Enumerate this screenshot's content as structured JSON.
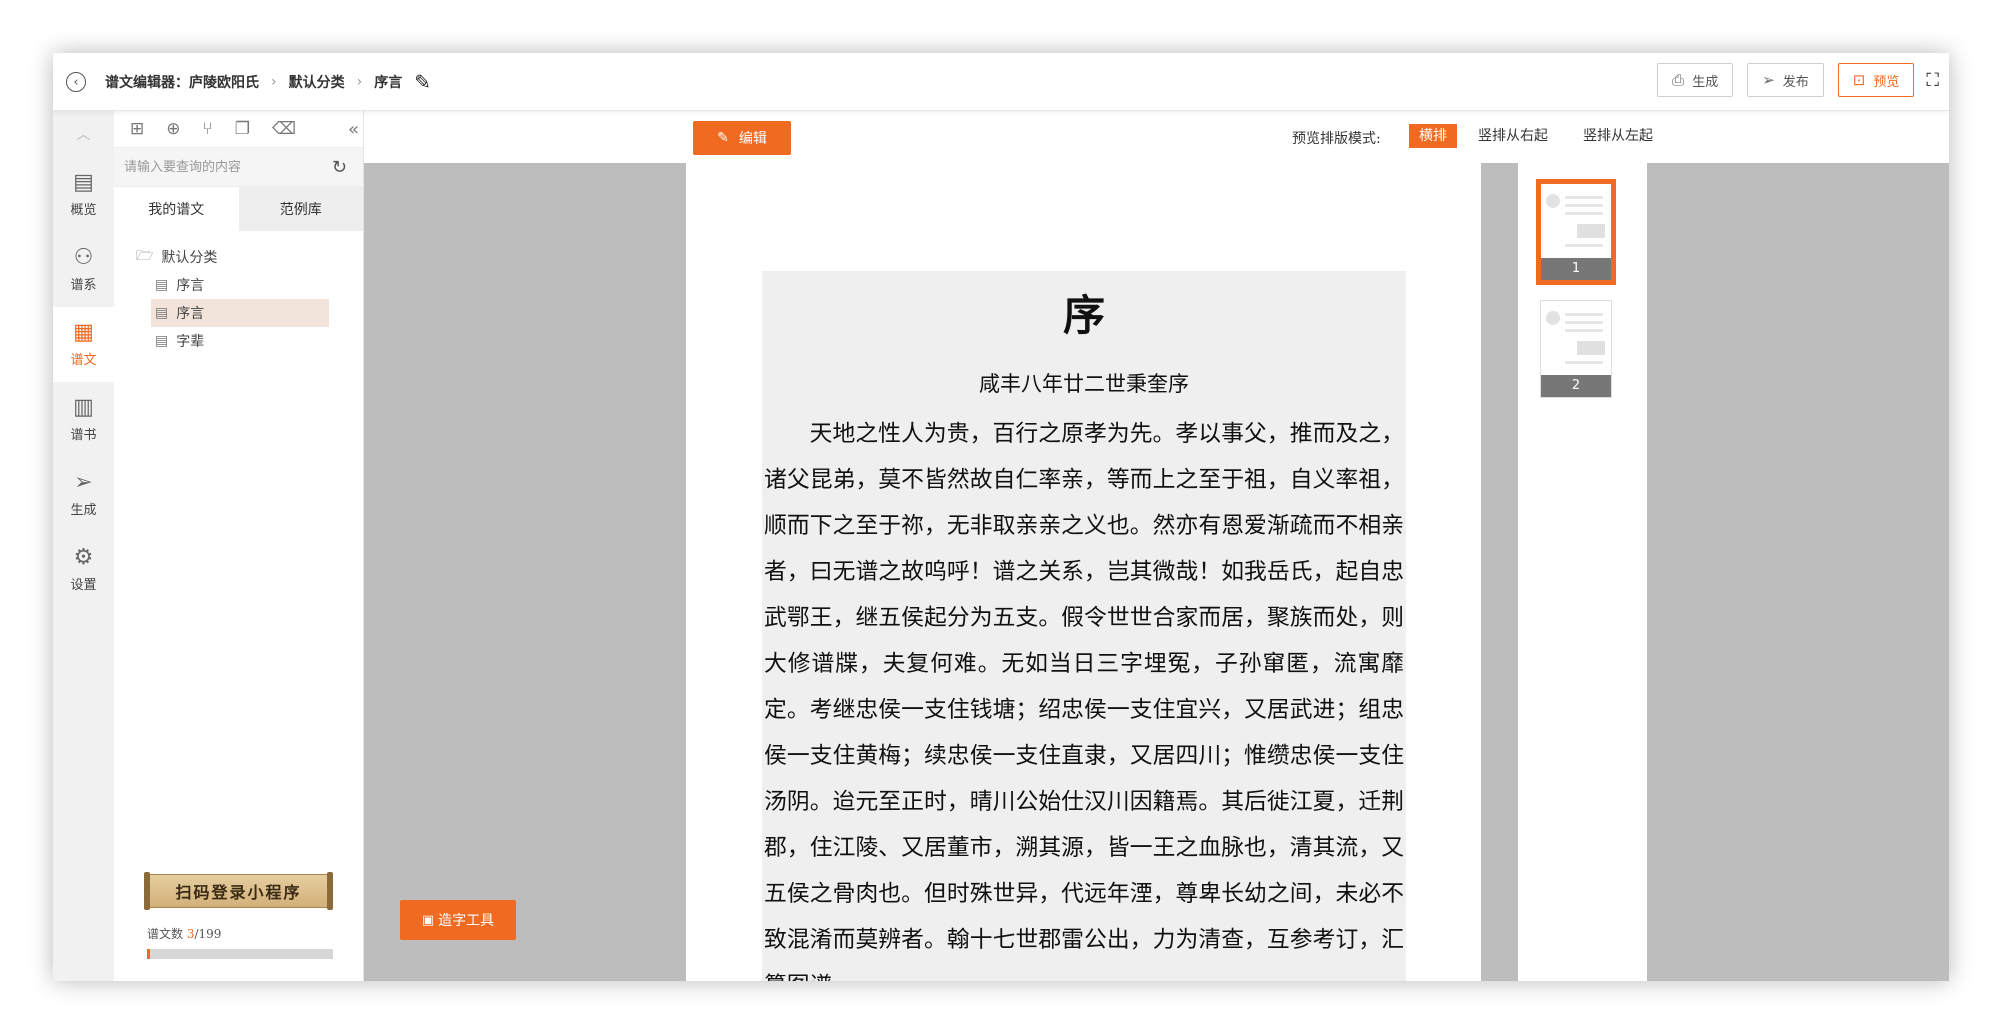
{
  "header": {
    "back_icon": "chevron-left-circle-icon",
    "breadcrumbs": [
      "谱文编辑器：庐陵欧阳氏",
      "默认分类",
      "序言"
    ],
    "actions": {
      "generate": "生成",
      "publish": "发布",
      "preview": "预览"
    }
  },
  "leftnav": {
    "items": [
      {
        "label": "概览",
        "icon": "chart-icon"
      },
      {
        "label": "谱系",
        "icon": "tree-icon"
      },
      {
        "label": "谱文",
        "icon": "document-icon"
      },
      {
        "label": "谱书",
        "icon": "book-icon"
      },
      {
        "label": "生成",
        "icon": "send-icon"
      },
      {
        "label": "设置",
        "icon": "gear-icon"
      }
    ],
    "active": "谱文"
  },
  "filepanel": {
    "search_placeholder": "请输入要查询的内容",
    "tabs": [
      "我的谱文",
      "范例库"
    ],
    "folder": "默认分类",
    "files": [
      "序言",
      "序言",
      "字辈"
    ],
    "banner": "扫码登录小程序",
    "count_label": "谱文数",
    "count_current": "3",
    "count_total": "/199",
    "count_fraction": 0.015
  },
  "toolbar": {
    "edit_label": "编辑",
    "mode_label": "预览排版模式:",
    "modes": [
      "横排",
      "竖排从右起",
      "竖排从左起"
    ],
    "active_mode": "横排"
  },
  "document": {
    "title": "序",
    "subtitle": "咸丰八年廿二世秉奎序",
    "body": "天地之性人为贵，百行之原孝为先。孝以事父，推而及之，诸父昆弟，莫不皆然故自仁率亲，等而上之至于祖，自义率祖，顺而下之至于祢，无非取亲亲之义也。然亦有恩爱渐疏而不相亲者，曰无谱之故呜呼！谱之关系，岂其微哉！如我岳氏，起自忠武鄂王，继五侯起分为五支。假令世世合家而居，聚族而处，则大修谱牒，夫复何难。无如当日三字埋冤，子孙窜匿，流寓靡定。考继忠侯一支住钱塘；绍忠侯一支住宜兴，又居武进；组忠侯一支住黄梅；续忠侯一支住直隶，又居四川；惟缵忠侯一支住汤阴。迨元至正时，晴川公始仕汉川因籍焉。其后徙江夏，迁荆郡，住江陵、又居董市，溯其源，皆一王之血脉也，清其流，又五侯之骨肉也。但时殊世异，代远年湮，尊卑长幼之间，未必不致混淆而莫辨者。翰十七世郡雷公出，力为清查，互参考订，汇纂图谱"
  },
  "tools": {
    "zaozi_label": "造字工具"
  },
  "thumbnails": {
    "pages": [
      "1",
      "2"
    ],
    "active": "1"
  }
}
